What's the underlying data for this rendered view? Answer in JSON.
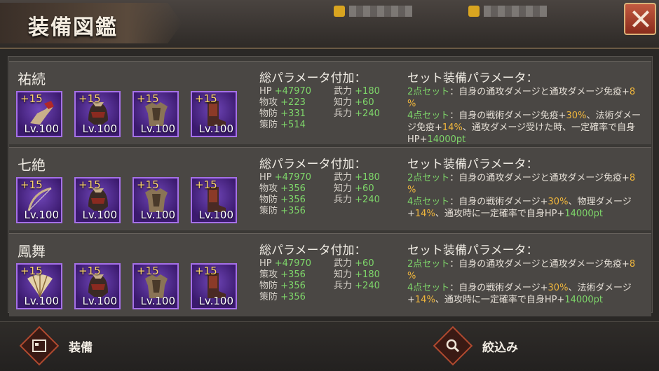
{
  "header": {
    "title": "装備図鑑"
  },
  "colors": {
    "rarity_border": "#a570e8",
    "value_green": "#7ed66a",
    "value_yellow": "#f0b63c",
    "accent_red": "#b04a30"
  },
  "sets": [
    {
      "name": "祐続",
      "items": [
        {
          "icon": "gauntlet-icon",
          "plus": "+15",
          "level": "Lv.100"
        },
        {
          "icon": "helmet-icon",
          "plus": "+15",
          "level": "Lv.100"
        },
        {
          "icon": "armor-icon",
          "plus": "+15",
          "level": "Lv.100"
        },
        {
          "icon": "boots-icon",
          "plus": "+15",
          "level": "Lv.100"
        }
      ],
      "params_title": "総パラメータ付加：",
      "params": [
        {
          "label": "HP",
          "value": "+47970"
        },
        {
          "label": "武力",
          "value": "+180"
        },
        {
          "label": "物攻",
          "value": "+223"
        },
        {
          "label": "知力",
          "value": "+60"
        },
        {
          "label": "物防",
          "value": "+331"
        },
        {
          "label": "兵力",
          "value": "+240"
        },
        {
          "label": "策防",
          "value": "+514"
        }
      ],
      "set_title": "セット装備パラメータ：",
      "set_effects": [
        {
          "count": "2点セット",
          "text": "：自身の通攻ダメージと通攻ダメージ免疫+",
          "value": "8",
          "tail": "%"
        },
        {
          "count": "4点セット",
          "text": "：自身の戦術ダメージ免疫+",
          "v1": "30%",
          "t2": "、法術ダメージ免疫+",
          "v2": "14%",
          "t3": "、通攻ダメージ受けた時、一定確率で自身HP+",
          "v3": "14000pt"
        }
      ]
    },
    {
      "name": "七絶",
      "items": [
        {
          "icon": "bow-icon",
          "plus": "+15",
          "level": "Lv.100"
        },
        {
          "icon": "helmet-icon",
          "plus": "+15",
          "level": "Lv.100"
        },
        {
          "icon": "armor-icon",
          "plus": "+15",
          "level": "Lv.100"
        },
        {
          "icon": "boots-icon",
          "plus": "+15",
          "level": "Lv.100"
        }
      ],
      "params_title": "総パラメータ付加：",
      "params": [
        {
          "label": "HP",
          "value": "+47970"
        },
        {
          "label": "武力",
          "value": "+180"
        },
        {
          "label": "物攻",
          "value": "+356"
        },
        {
          "label": "知力",
          "value": "+60"
        },
        {
          "label": "物防",
          "value": "+356"
        },
        {
          "label": "兵力",
          "value": "+240"
        },
        {
          "label": "策防",
          "value": "+356"
        }
      ],
      "set_title": "セット装備パラメータ：",
      "set_effects": [
        {
          "count": "2点セット",
          "text": "：自身の通攻ダメージと通攻ダメージ免疫+",
          "value": "8",
          "tail": "%"
        },
        {
          "count": "4点セット",
          "text": "：自身の戦術ダメージ+",
          "v1": "30%",
          "t2": "、物理ダメージ+",
          "v2": "14%",
          "t3": "、通攻時に一定確率で自身HP+",
          "v3": "14000pt"
        }
      ]
    },
    {
      "name": "鳳舞",
      "items": [
        {
          "icon": "fan-icon",
          "plus": "+15",
          "level": "Lv.100"
        },
        {
          "icon": "helmet-icon",
          "plus": "+15",
          "level": "Lv.100"
        },
        {
          "icon": "armor-icon",
          "plus": "+15",
          "level": "Lv.100"
        },
        {
          "icon": "boots-icon",
          "plus": "+15",
          "level": "Lv.100"
        }
      ],
      "params_title": "総パラメータ付加：",
      "params": [
        {
          "label": "HP",
          "value": "+47970"
        },
        {
          "label": "武力",
          "value": "+60"
        },
        {
          "label": "策攻",
          "value": "+356"
        },
        {
          "label": "知力",
          "value": "+180"
        },
        {
          "label": "物防",
          "value": "+356"
        },
        {
          "label": "兵力",
          "value": "+240"
        },
        {
          "label": "策防",
          "value": "+356"
        }
      ],
      "set_title": "セット装備パラメータ：",
      "set_effects": [
        {
          "count": "2点セット",
          "text": "：自身の通攻ダメージと通攻ダメージ免疫+",
          "value": "8",
          "tail": "%"
        },
        {
          "count": "4点セット",
          "text": "：自身の戦術ダメージ+",
          "v1": "30%",
          "t2": "、法術ダメージ+",
          "v2": "14%",
          "t3": "、通攻時に一定確率で自身HP+",
          "v3": "14000pt"
        }
      ]
    }
  ],
  "footer": {
    "equip_label": "装備",
    "filter_label": "絞込み"
  }
}
